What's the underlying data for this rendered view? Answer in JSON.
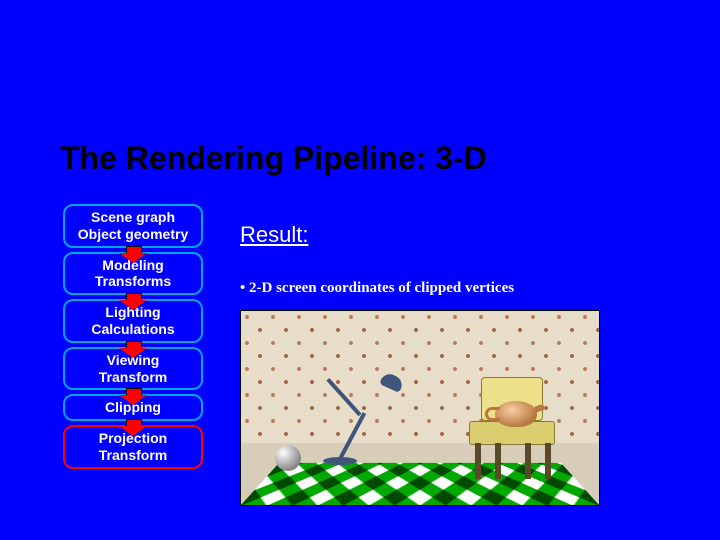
{
  "title": "The Rendering Pipeline: 3-D",
  "pipeline": {
    "stages": [
      {
        "line1": "Scene graph",
        "line2": "Object geometry",
        "current": false
      },
      {
        "line1": "Modeling",
        "line2": "Transforms",
        "current": false
      },
      {
        "line1": "Lighting",
        "line2": "Calculations",
        "current": false
      },
      {
        "line1": "Viewing",
        "line2": "Transform",
        "current": false
      },
      {
        "line1": "Clipping",
        "line2": "",
        "current": false
      },
      {
        "line1": "Projection",
        "line2": "Transform",
        "current": true
      }
    ]
  },
  "result": {
    "heading": "Result:",
    "bullet": "• 2-D screen coordinates of clipped vertices"
  }
}
